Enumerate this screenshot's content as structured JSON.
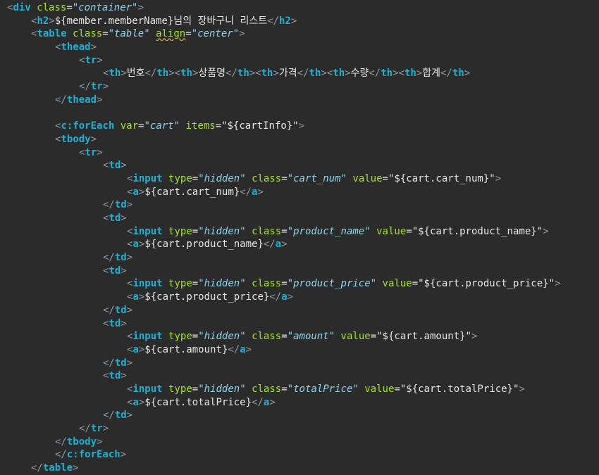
{
  "editor": {
    "background": "#2b2b2b",
    "colors": {
      "bracket": "#8a9aa6",
      "tag": "#1fb0d2",
      "attribute": "#a6e22e",
      "attribute_value": "#8fd5ec",
      "text": "#e6e6e6",
      "warning_underline": "#c8a22a"
    },
    "lines": [
      {
        "indent": 0,
        "tokens": [
          {
            "t": "brk",
            "v": "<"
          },
          {
            "t": "tag",
            "v": "div"
          },
          {
            "t": "text",
            "v": " "
          },
          {
            "t": "attr",
            "v": "class"
          },
          {
            "t": "text",
            "v": "="
          },
          {
            "t": "val",
            "v": "\"container\""
          },
          {
            "t": "brk",
            "v": ">"
          }
        ]
      },
      {
        "indent": 1,
        "tokens": [
          {
            "t": "brk",
            "v": "<"
          },
          {
            "t": "tag",
            "v": "h2"
          },
          {
            "t": "brk",
            "v": ">"
          },
          {
            "t": "text",
            "v": "${member.memberName}님의 장바구니 리스트"
          },
          {
            "t": "brk",
            "v": "</"
          },
          {
            "t": "tag",
            "v": "h2"
          },
          {
            "t": "brk",
            "v": ">"
          }
        ]
      },
      {
        "indent": 1,
        "tokens": [
          {
            "t": "brk",
            "v": "<"
          },
          {
            "t": "tag",
            "v": "table"
          },
          {
            "t": "text",
            "v": " "
          },
          {
            "t": "attr",
            "v": "class"
          },
          {
            "t": "text",
            "v": "="
          },
          {
            "t": "val",
            "v": "\"table\""
          },
          {
            "t": "text",
            "v": " "
          },
          {
            "t": "attr",
            "v": "align",
            "warn": true
          },
          {
            "t": "text",
            "v": "="
          },
          {
            "t": "val",
            "v": "\"center\""
          },
          {
            "t": "brk",
            "v": ">"
          }
        ]
      },
      {
        "indent": 2,
        "tokens": [
          {
            "t": "brk",
            "v": "<"
          },
          {
            "t": "tag",
            "v": "thead"
          },
          {
            "t": "brk",
            "v": ">"
          }
        ]
      },
      {
        "indent": 3,
        "tokens": [
          {
            "t": "brk",
            "v": "<"
          },
          {
            "t": "tag",
            "v": "tr"
          },
          {
            "t": "brk",
            "v": ">"
          }
        ]
      },
      {
        "indent": 4,
        "tokens": [
          {
            "t": "brk",
            "v": "<"
          },
          {
            "t": "tag",
            "v": "th"
          },
          {
            "t": "brk",
            "v": ">"
          },
          {
            "t": "text",
            "v": "번호"
          },
          {
            "t": "brk",
            "v": "</"
          },
          {
            "t": "tag",
            "v": "th"
          },
          {
            "t": "brk",
            "v": ">"
          },
          {
            "t": "brk",
            "v": "<"
          },
          {
            "t": "tag",
            "v": "th"
          },
          {
            "t": "brk",
            "v": ">"
          },
          {
            "t": "text",
            "v": "상품명"
          },
          {
            "t": "brk",
            "v": "</"
          },
          {
            "t": "tag",
            "v": "th"
          },
          {
            "t": "brk",
            "v": ">"
          },
          {
            "t": "brk",
            "v": "<"
          },
          {
            "t": "tag",
            "v": "th"
          },
          {
            "t": "brk",
            "v": ">"
          },
          {
            "t": "text",
            "v": "가격"
          },
          {
            "t": "brk",
            "v": "</"
          },
          {
            "t": "tag",
            "v": "th"
          },
          {
            "t": "brk",
            "v": ">"
          },
          {
            "t": "brk",
            "v": "<"
          },
          {
            "t": "tag",
            "v": "th"
          },
          {
            "t": "brk",
            "v": ">"
          },
          {
            "t": "text",
            "v": "수량"
          },
          {
            "t": "brk",
            "v": "</"
          },
          {
            "t": "tag",
            "v": "th"
          },
          {
            "t": "brk",
            "v": ">"
          },
          {
            "t": "brk",
            "v": "<"
          },
          {
            "t": "tag",
            "v": "th"
          },
          {
            "t": "brk",
            "v": ">"
          },
          {
            "t": "text",
            "v": "합계"
          },
          {
            "t": "brk",
            "v": "</"
          },
          {
            "t": "tag",
            "v": "th"
          },
          {
            "t": "brk",
            "v": ">"
          }
        ]
      },
      {
        "indent": 3,
        "tokens": [
          {
            "t": "brk",
            "v": "</"
          },
          {
            "t": "tag",
            "v": "tr"
          },
          {
            "t": "brk",
            "v": ">"
          }
        ]
      },
      {
        "indent": 2,
        "tokens": [
          {
            "t": "brk",
            "v": "</"
          },
          {
            "t": "tag",
            "v": "thead"
          },
          {
            "t": "brk",
            "v": ">"
          }
        ]
      },
      {
        "indent": 0,
        "tokens": []
      },
      {
        "indent": 2,
        "tokens": [
          {
            "t": "brk",
            "v": "<"
          },
          {
            "t": "tag",
            "v": "c:forEach"
          },
          {
            "t": "text",
            "v": " "
          },
          {
            "t": "attr",
            "v": "var"
          },
          {
            "t": "text",
            "v": "="
          },
          {
            "t": "val",
            "v": "\"cart\""
          },
          {
            "t": "text",
            "v": " "
          },
          {
            "t": "attr",
            "v": "items"
          },
          {
            "t": "text",
            "v": "=\"${cartInfo}\""
          },
          {
            "t": "brk",
            "v": ">"
          }
        ]
      },
      {
        "indent": 2,
        "tokens": [
          {
            "t": "brk",
            "v": "<"
          },
          {
            "t": "tag",
            "v": "tbody"
          },
          {
            "t": "brk",
            "v": ">"
          }
        ]
      },
      {
        "indent": 3,
        "tokens": [
          {
            "t": "brk",
            "v": "<"
          },
          {
            "t": "tag",
            "v": "tr"
          },
          {
            "t": "brk",
            "v": ">"
          }
        ]
      },
      {
        "indent": 4,
        "tokens": [
          {
            "t": "brk",
            "v": "<"
          },
          {
            "t": "tag",
            "v": "td"
          },
          {
            "t": "brk",
            "v": ">"
          }
        ]
      },
      {
        "indent": 5,
        "tokens": [
          {
            "t": "brk",
            "v": "<"
          },
          {
            "t": "tag",
            "v": "input"
          },
          {
            "t": "text",
            "v": " "
          },
          {
            "t": "attr",
            "v": "type"
          },
          {
            "t": "text",
            "v": "="
          },
          {
            "t": "val",
            "v": "\"hidden\""
          },
          {
            "t": "text",
            "v": " "
          },
          {
            "t": "attr",
            "v": "class"
          },
          {
            "t": "text",
            "v": "="
          },
          {
            "t": "val",
            "v": "\"cart_num\""
          },
          {
            "t": "text",
            "v": " "
          },
          {
            "t": "attr",
            "v": "value"
          },
          {
            "t": "text",
            "v": "=\"${cart.cart_num}\""
          },
          {
            "t": "brk",
            "v": ">"
          }
        ]
      },
      {
        "indent": 5,
        "tokens": [
          {
            "t": "brk",
            "v": "<"
          },
          {
            "t": "tag",
            "v": "a"
          },
          {
            "t": "brk",
            "v": ">"
          },
          {
            "t": "text",
            "v": "${cart.cart_num}"
          },
          {
            "t": "brk",
            "v": "</"
          },
          {
            "t": "tag",
            "v": "a"
          },
          {
            "t": "brk",
            "v": ">"
          }
        ]
      },
      {
        "indent": 4,
        "tokens": [
          {
            "t": "brk",
            "v": "</"
          },
          {
            "t": "tag",
            "v": "td"
          },
          {
            "t": "brk",
            "v": ">"
          }
        ]
      },
      {
        "indent": 4,
        "tokens": [
          {
            "t": "brk",
            "v": "<"
          },
          {
            "t": "tag",
            "v": "td"
          },
          {
            "t": "brk",
            "v": ">"
          }
        ]
      },
      {
        "indent": 5,
        "tokens": [
          {
            "t": "brk",
            "v": "<"
          },
          {
            "t": "tag",
            "v": "input"
          },
          {
            "t": "text",
            "v": " "
          },
          {
            "t": "attr",
            "v": "type"
          },
          {
            "t": "text",
            "v": "="
          },
          {
            "t": "val",
            "v": "\"hidden\""
          },
          {
            "t": "text",
            "v": " "
          },
          {
            "t": "attr",
            "v": "class"
          },
          {
            "t": "text",
            "v": "="
          },
          {
            "t": "val",
            "v": "\"product_name\""
          },
          {
            "t": "text",
            "v": " "
          },
          {
            "t": "attr",
            "v": "value"
          },
          {
            "t": "text",
            "v": "=\"${cart.product_name}\""
          },
          {
            "t": "brk",
            "v": ">"
          }
        ]
      },
      {
        "indent": 5,
        "tokens": [
          {
            "t": "brk",
            "v": "<"
          },
          {
            "t": "tag",
            "v": "a"
          },
          {
            "t": "brk",
            "v": ">"
          },
          {
            "t": "text",
            "v": "${cart.product_name}"
          },
          {
            "t": "brk",
            "v": "</"
          },
          {
            "t": "tag",
            "v": "a"
          },
          {
            "t": "brk",
            "v": ">"
          }
        ]
      },
      {
        "indent": 4,
        "tokens": [
          {
            "t": "brk",
            "v": "</"
          },
          {
            "t": "tag",
            "v": "td"
          },
          {
            "t": "brk",
            "v": ">"
          }
        ]
      },
      {
        "indent": 4,
        "tokens": [
          {
            "t": "brk",
            "v": "<"
          },
          {
            "t": "tag",
            "v": "td"
          },
          {
            "t": "brk",
            "v": ">"
          }
        ]
      },
      {
        "indent": 5,
        "tokens": [
          {
            "t": "brk",
            "v": "<"
          },
          {
            "t": "tag",
            "v": "input"
          },
          {
            "t": "text",
            "v": " "
          },
          {
            "t": "attr",
            "v": "type"
          },
          {
            "t": "text",
            "v": "="
          },
          {
            "t": "val",
            "v": "\"hidden\""
          },
          {
            "t": "text",
            "v": " "
          },
          {
            "t": "attr",
            "v": "class"
          },
          {
            "t": "text",
            "v": "="
          },
          {
            "t": "val",
            "v": "\"product_price\""
          },
          {
            "t": "text",
            "v": " "
          },
          {
            "t": "attr",
            "v": "value"
          },
          {
            "t": "text",
            "v": "=\"${cart.product_price}\""
          },
          {
            "t": "brk",
            "v": ">"
          }
        ]
      },
      {
        "indent": 5,
        "tokens": [
          {
            "t": "brk",
            "v": "<"
          },
          {
            "t": "tag",
            "v": "a"
          },
          {
            "t": "brk",
            "v": ">"
          },
          {
            "t": "text",
            "v": "${cart.product_price}"
          },
          {
            "t": "brk",
            "v": "</"
          },
          {
            "t": "tag",
            "v": "a"
          },
          {
            "t": "brk",
            "v": ">"
          }
        ]
      },
      {
        "indent": 4,
        "tokens": [
          {
            "t": "brk",
            "v": "</"
          },
          {
            "t": "tag",
            "v": "td"
          },
          {
            "t": "brk",
            "v": ">"
          }
        ]
      },
      {
        "indent": 4,
        "tokens": [
          {
            "t": "brk",
            "v": "<"
          },
          {
            "t": "tag",
            "v": "td"
          },
          {
            "t": "brk",
            "v": ">"
          }
        ]
      },
      {
        "indent": 5,
        "tokens": [
          {
            "t": "brk",
            "v": "<"
          },
          {
            "t": "tag",
            "v": "input"
          },
          {
            "t": "text",
            "v": " "
          },
          {
            "t": "attr",
            "v": "type"
          },
          {
            "t": "text",
            "v": "="
          },
          {
            "t": "val",
            "v": "\"hidden\""
          },
          {
            "t": "text",
            "v": " "
          },
          {
            "t": "attr",
            "v": "class"
          },
          {
            "t": "text",
            "v": "="
          },
          {
            "t": "val",
            "v": "\"amount\""
          },
          {
            "t": "text",
            "v": " "
          },
          {
            "t": "attr",
            "v": "value"
          },
          {
            "t": "text",
            "v": "=\"${cart.amount}\""
          },
          {
            "t": "brk",
            "v": ">"
          }
        ]
      },
      {
        "indent": 5,
        "tokens": [
          {
            "t": "brk",
            "v": "<"
          },
          {
            "t": "tag",
            "v": "a"
          },
          {
            "t": "brk",
            "v": ">"
          },
          {
            "t": "text",
            "v": "${cart.amount}"
          },
          {
            "t": "brk",
            "v": "</"
          },
          {
            "t": "tag",
            "v": "a"
          },
          {
            "t": "brk",
            "v": ">"
          }
        ]
      },
      {
        "indent": 4,
        "tokens": [
          {
            "t": "brk",
            "v": "</"
          },
          {
            "t": "tag",
            "v": "td"
          },
          {
            "t": "brk",
            "v": ">"
          }
        ]
      },
      {
        "indent": 4,
        "tokens": [
          {
            "t": "brk",
            "v": "<"
          },
          {
            "t": "tag",
            "v": "td"
          },
          {
            "t": "brk",
            "v": ">"
          }
        ]
      },
      {
        "indent": 5,
        "tokens": [
          {
            "t": "brk",
            "v": "<"
          },
          {
            "t": "tag",
            "v": "input"
          },
          {
            "t": "text",
            "v": " "
          },
          {
            "t": "attr",
            "v": "type"
          },
          {
            "t": "text",
            "v": "="
          },
          {
            "t": "val",
            "v": "\"hidden\""
          },
          {
            "t": "text",
            "v": " "
          },
          {
            "t": "attr",
            "v": "class"
          },
          {
            "t": "text",
            "v": "="
          },
          {
            "t": "val",
            "v": "\"totalPrice\""
          },
          {
            "t": "text",
            "v": " "
          },
          {
            "t": "attr",
            "v": "value"
          },
          {
            "t": "text",
            "v": "=\"${cart.totalPrice}\""
          },
          {
            "t": "brk",
            "v": ">"
          }
        ]
      },
      {
        "indent": 5,
        "tokens": [
          {
            "t": "brk",
            "v": "<"
          },
          {
            "t": "tag",
            "v": "a"
          },
          {
            "t": "brk",
            "v": ">"
          },
          {
            "t": "text",
            "v": "${cart.totalPrice}"
          },
          {
            "t": "brk",
            "v": "</"
          },
          {
            "t": "tag",
            "v": "a"
          },
          {
            "t": "brk",
            "v": ">"
          }
        ]
      },
      {
        "indent": 4,
        "tokens": [
          {
            "t": "brk",
            "v": "</"
          },
          {
            "t": "tag",
            "v": "td"
          },
          {
            "t": "brk",
            "v": ">"
          }
        ]
      },
      {
        "indent": 3,
        "tokens": [
          {
            "t": "brk",
            "v": "</"
          },
          {
            "t": "tag",
            "v": "tr"
          },
          {
            "t": "brk",
            "v": ">"
          }
        ]
      },
      {
        "indent": 2,
        "tokens": [
          {
            "t": "brk",
            "v": "</"
          },
          {
            "t": "tag",
            "v": "tbody"
          },
          {
            "t": "brk",
            "v": ">"
          }
        ]
      },
      {
        "indent": 2,
        "tokens": [
          {
            "t": "brk",
            "v": "</"
          },
          {
            "t": "tag",
            "v": "c:forEach"
          },
          {
            "t": "brk",
            "v": ">"
          }
        ]
      },
      {
        "indent": 1,
        "tokens": [
          {
            "t": "brk",
            "v": "</"
          },
          {
            "t": "tag",
            "v": "table"
          },
          {
            "t": "brk",
            "v": ">"
          }
        ]
      }
    ]
  }
}
